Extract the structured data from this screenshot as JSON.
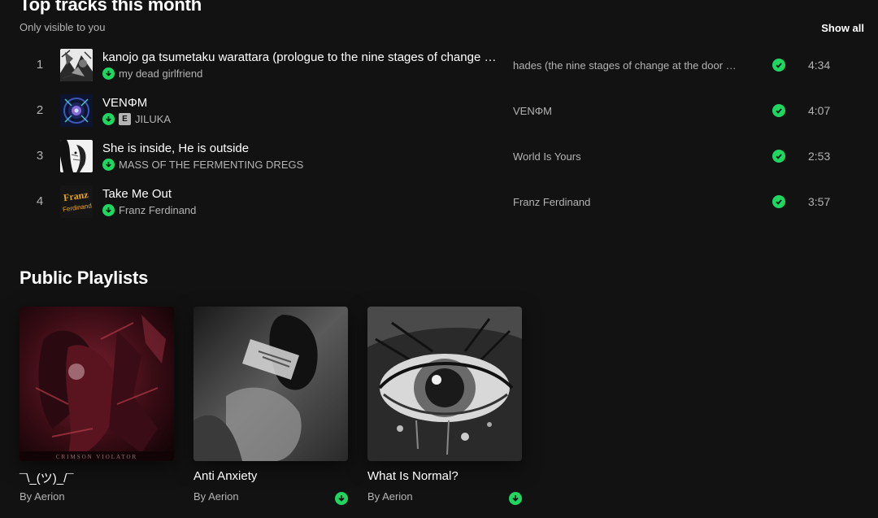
{
  "top_tracks": {
    "title": "Top tracks this month",
    "subtitle": "Only visible to you",
    "show_all_label": "Show all",
    "tracks": [
      {
        "index": "1",
        "title": "kanojo ga tsumetaku warattara (prologue to the nine stages of change at the door of death)",
        "artist": "my dead girlfriend",
        "explicit": false,
        "album": "hades (the nine stages of change at the door of death)",
        "duration": "4:34",
        "cover_icon": "album-art-manga"
      },
      {
        "index": "2",
        "title": "VENΦM",
        "artist": "JILUKA",
        "explicit": true,
        "explicit_label": "E",
        "album": "VENΦM",
        "duration": "4:07",
        "cover_icon": "album-art-venom"
      },
      {
        "index": "3",
        "title": "She is inside, He is outside",
        "artist": "MASS OF THE FERMENTING DREGS",
        "explicit": false,
        "album": "World Is Yours",
        "duration": "2:53",
        "cover_icon": "album-art-sketch"
      },
      {
        "index": "4",
        "title": "Take Me Out",
        "artist": "Franz Ferdinand",
        "explicit": false,
        "album": "Franz Ferdinand",
        "duration": "3:57",
        "cover_icon": "album-art-franz",
        "cover_text_1": "Franz",
        "cover_text_2": "Ferdinand"
      }
    ]
  },
  "public_playlists": {
    "title": "Public Playlists",
    "items": [
      {
        "name": "¯\\_(ツ)_/¯",
        "owner": "By Aerion",
        "downloaded": false,
        "art_caption": "CRIMSON VIOLATOR"
      },
      {
        "name": "Anti Anxiety",
        "owner": "By Aerion",
        "downloaded": true
      },
      {
        "name": "What Is Normal?",
        "owner": "By Aerion",
        "downloaded": true
      }
    ]
  },
  "colors": {
    "background": "#121212",
    "accent_green": "#1ed760",
    "text_primary": "#ffffff",
    "text_secondary": "#b3b3b3"
  }
}
